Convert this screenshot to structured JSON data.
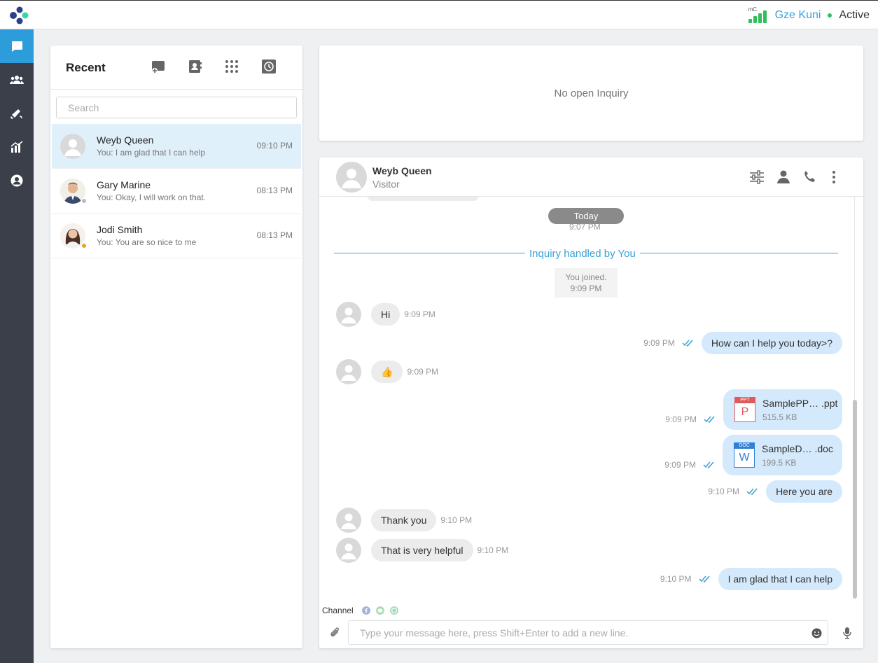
{
  "topbar": {
    "network_label": "mC",
    "user_name": "Gze Kuni",
    "status": "Active"
  },
  "rail": {
    "items": [
      "chat-icon",
      "team-icon",
      "campaign-icon",
      "analytics-icon",
      "profile-icon"
    ]
  },
  "recent": {
    "title": "Recent",
    "search_placeholder": "Search",
    "conversations": [
      {
        "name": "Weyb Queen",
        "preview": "You: I am glad that I can help",
        "time": "09:10 PM"
      },
      {
        "name": "Gary Marine",
        "preview": "You: Okay, I will work on that.",
        "time": "08:13 PM"
      },
      {
        "name": "Jodi Smith",
        "preview": "You: You are so nice to me",
        "time": "08:13 PM"
      }
    ]
  },
  "inquiry": {
    "empty_text": "No open Inquiry"
  },
  "chat": {
    "name": "Weyb Queen",
    "role": "Visitor",
    "today_label": "Today",
    "cut_time": "9:07 PM",
    "handled_text": "Inquiry handled by You",
    "system": {
      "line1": "You joined.",
      "line2": "9:09 PM"
    },
    "messages": {
      "m1": {
        "text": "Hi",
        "time": "9:09 PM"
      },
      "m2": {
        "text": "How can I help you today>?",
        "time": "9:09 PM"
      },
      "m3": {
        "text": "👍",
        "time": "9:09 PM"
      },
      "m4": {
        "tag": "PPT",
        "letter": "P",
        "name": "SamplePP… .ppt",
        "size": "515.5 KB",
        "time": "9:09 PM"
      },
      "m5": {
        "tag": "DOC",
        "letter": "W",
        "name": "SampleD…  .doc",
        "size": "199.5 KB",
        "time": "9:09 PM"
      },
      "m6": {
        "text": "Here you are",
        "time": "9:10 PM"
      },
      "m7": {
        "text": "Thank you",
        "time": "9:10 PM"
      },
      "m8": {
        "text": "That is very helpful",
        "time": "9:10 PM"
      },
      "m9": {
        "text": "I am glad that I can help",
        "time": "9:10 PM"
      }
    },
    "channel_label": "Channel",
    "composer_placeholder": "Type your message here, press Shift+Enter to add a new line."
  },
  "colors": {
    "accent": "#2d9cdb",
    "rail": "#3b3f4a",
    "online": "#2fbf5b",
    "outgoing_bubble": "#d4e9fb",
    "incoming_bubble": "#ececec"
  }
}
